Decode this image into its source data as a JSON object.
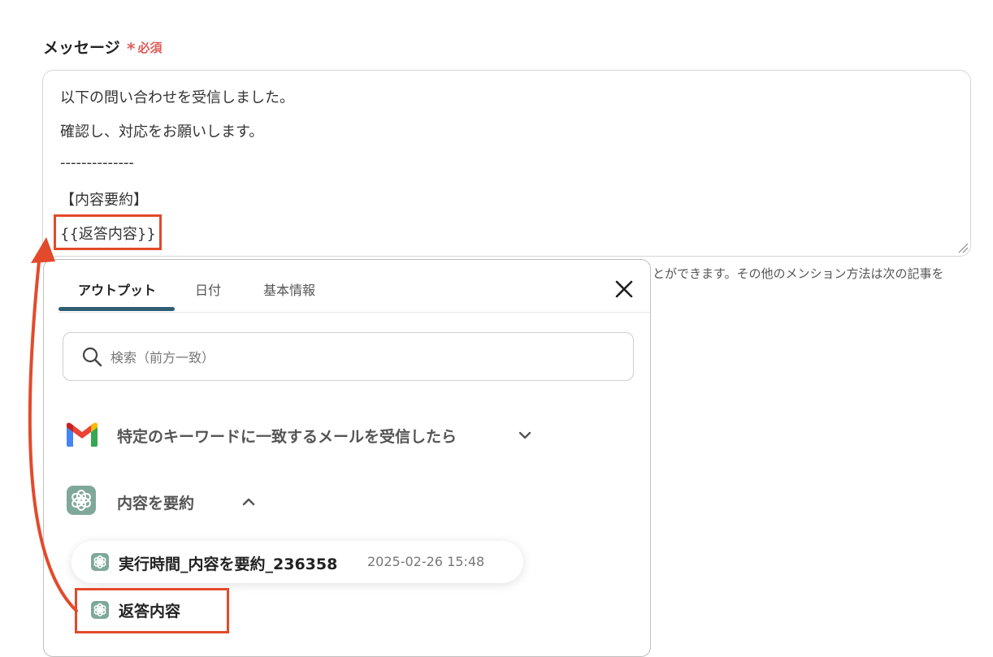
{
  "field": {
    "label": "メッセージ",
    "required_star": "*",
    "required_text": "必須"
  },
  "message": {
    "lines": [
      "以下の問い合わせを受信しました。",
      "確認し、対応をお願いします。",
      "--------------",
      "【内容要約】",
      "{{返答内容}}"
    ]
  },
  "hint_text": "とができます。その他のメンション方法は次の記事を",
  "popup": {
    "tabs": [
      {
        "label": "アウトプット",
        "active": true
      },
      {
        "label": "日付",
        "active": false
      },
      {
        "label": "基本情報",
        "active": false
      }
    ],
    "search": {
      "placeholder": "検索（前方一致）",
      "value": ""
    },
    "groups": [
      {
        "title": "特定のキーワードに一致するメールを受信したら",
        "icon": "gmail-icon",
        "expanded": false
      },
      {
        "title": "内容を要約",
        "icon": "chatgpt-icon",
        "expanded": true
      }
    ],
    "items": [
      {
        "label": "実行時間_内容を要約_236358",
        "time": "2025-02-26 15:48",
        "icon": "chatgpt-icon"
      },
      {
        "label": "返答内容",
        "icon": "chatgpt-icon"
      }
    ]
  },
  "colors": {
    "accent": "#2f5d73",
    "highlight": "#e34a2c",
    "required": "#e05a5a",
    "gpt_icon": "#7fa89a"
  }
}
